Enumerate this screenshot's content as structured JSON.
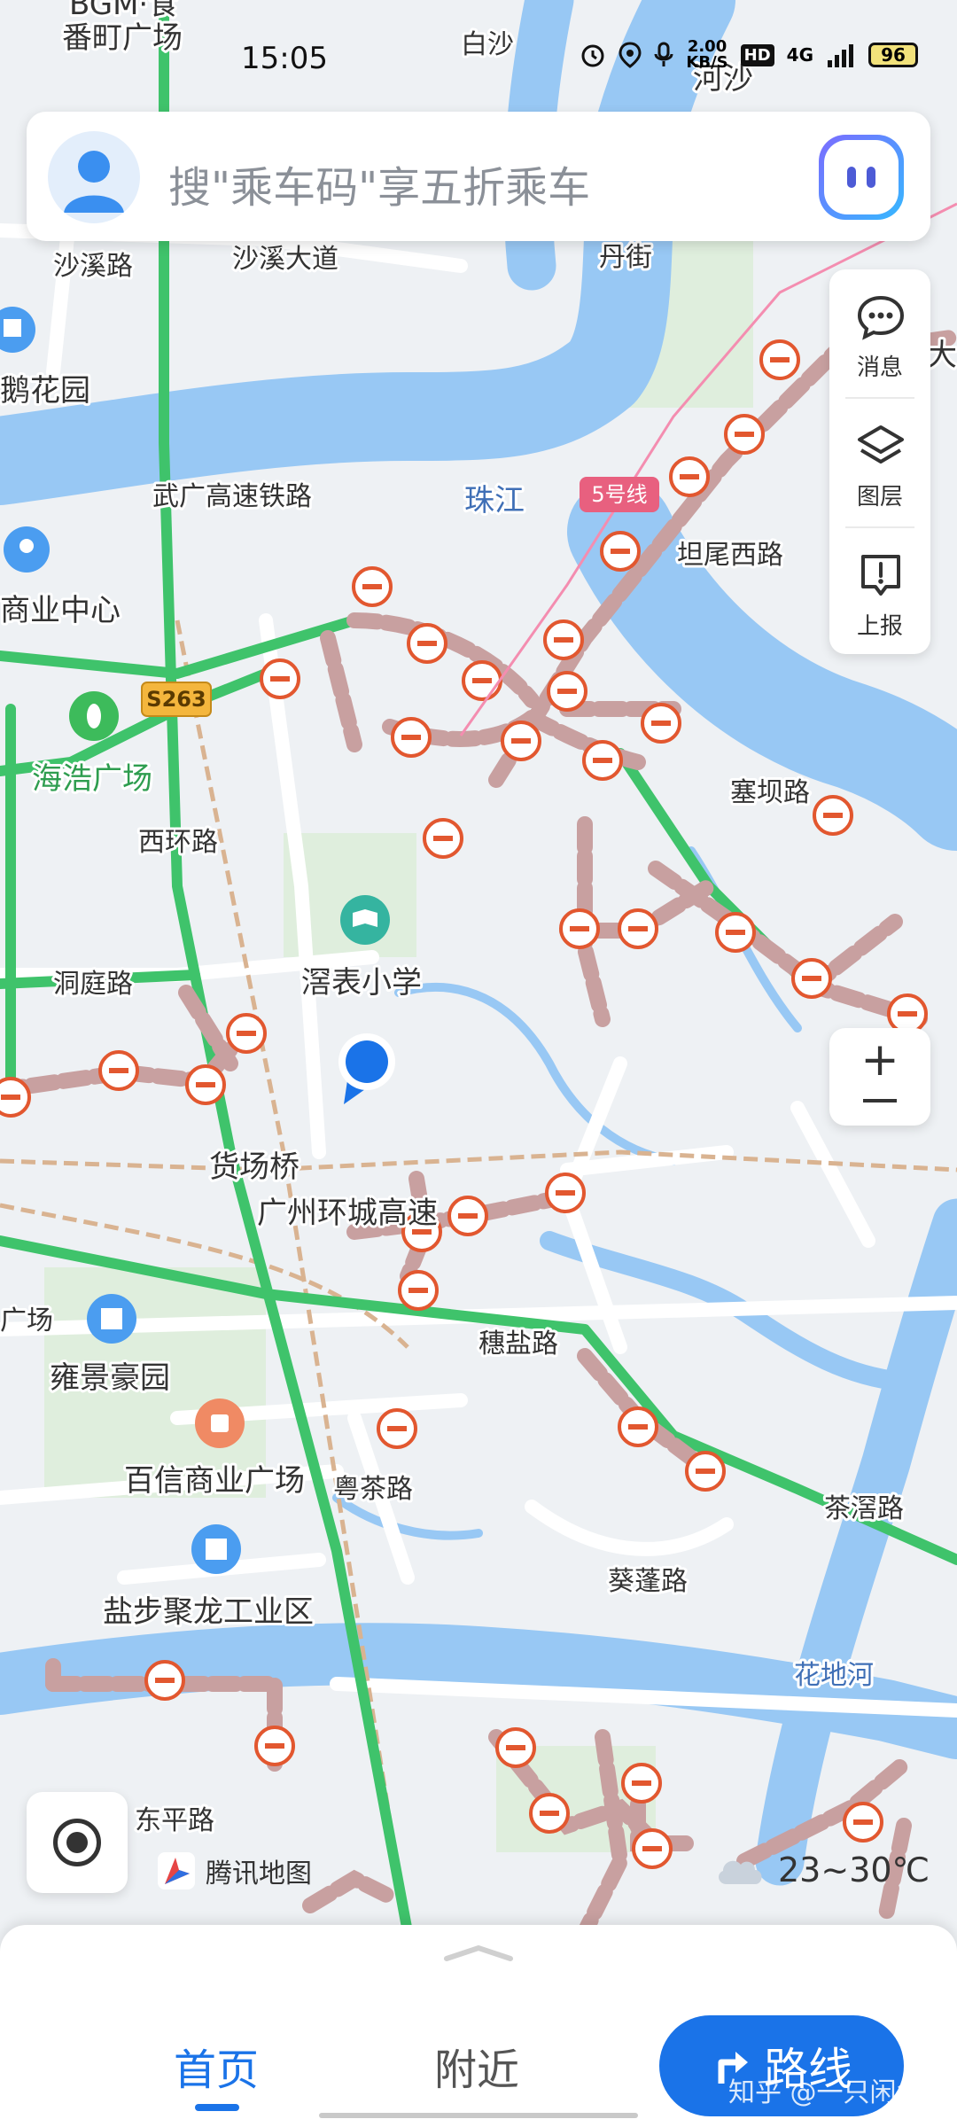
{
  "status_bar": {
    "time": "15:05",
    "speed_value": "2.00",
    "speed_unit": "KB/S",
    "hd": "HD",
    "network": "4G",
    "battery": "96"
  },
  "search": {
    "placeholder": "搜\"乘车码\"享五折乘车"
  },
  "tools": {
    "messages": "消息",
    "layers": "图层",
    "report": "上报"
  },
  "map": {
    "places": {
      "bgm": "BGM·食",
      "fanding": "番町广场",
      "baisha": "白沙",
      "hesha": "河沙",
      "shaxi_rd": "沙溪路",
      "shaxi_ave": "沙溪大道",
      "dan": "丹街",
      "huayuan": "鹅花园",
      "zhujiang": "珠江",
      "metro5": "5号线",
      "tanwei": "坦尾西路",
      "commercial": "商业中心",
      "wuguang": "武广高速铁路",
      "s263": "S263",
      "haihao": "海浩广场",
      "saiba": "塞坝路",
      "xihuan": "西环路",
      "jiaobiao": "滘表小学",
      "dongting": "洞庭路",
      "huochang": "货场桥",
      "huancheng": "广州环城高速",
      "suiyan": "穗盐路",
      "yongjing": "雍景豪园",
      "baixin": "百信商业广场",
      "yuejiao": "粤茶路",
      "kuipeng": "葵蓬路",
      "chaojiao": "茶滘路",
      "yanbu": "盐步聚龙工业区",
      "huadi": "花地河",
      "dongping": "东平路",
      "guang": "广场",
      "da": "大"
    }
  },
  "brand": {
    "name": "腾讯地图"
  },
  "weather": {
    "temp": "23~30℃"
  },
  "bottom_nav": {
    "home": "首页",
    "nearby": "附近",
    "route": "路线"
  },
  "watermark": "知乎 @一只闲鱼"
}
